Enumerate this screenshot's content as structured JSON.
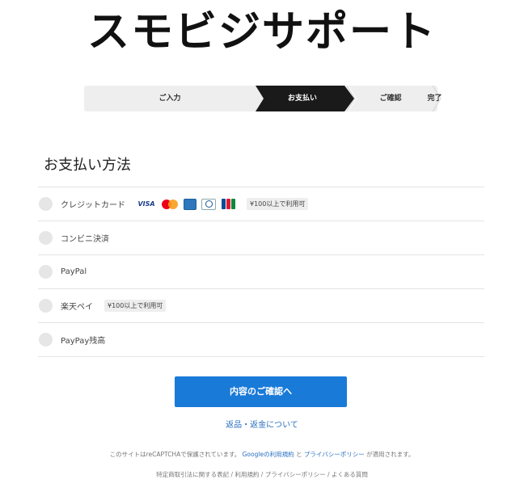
{
  "brand": {
    "title": "スモビジサポート"
  },
  "steps": [
    "ご入力",
    "お支払い",
    "ご確認",
    "完了"
  ],
  "payment": {
    "title": "お支払い方法",
    "options": [
      {
        "label": "クレジットカード",
        "badge": "¥100以上で利用可",
        "cards": [
          "visa-logo",
          "mastercard-logo",
          "amex-logo",
          "diners-logo",
          "jcb-logo"
        ]
      },
      {
        "label": "コンビニ決済"
      },
      {
        "label": "PayPal"
      },
      {
        "label": "楽天ペイ",
        "badge": "¥100以上で利用可"
      },
      {
        "label": "PayPay残高"
      }
    ],
    "visa_text": "VISA"
  },
  "actions": {
    "submit_label": "内容のご確認へ",
    "refund_link": "返品・返金について"
  },
  "footer": {
    "recaptcha_prefix": "このサイトはreCAPTCHAで保護されています。",
    "google_terms": "Googleの利用規約",
    "and": "と",
    "google_privacy": "プライバシーポリシー",
    "recaptcha_suffix": "が適用されます。",
    "links": [
      "特定商取引法に関する表記",
      "利用規約",
      "プライバシーポリシー",
      "よくある質問"
    ],
    "separator": " / "
  },
  "colors": {
    "primary": "#1a7ad8",
    "step_active": "#1a1a1a",
    "step_bg": "#eeeeee",
    "link": "#2a6fc1"
  }
}
